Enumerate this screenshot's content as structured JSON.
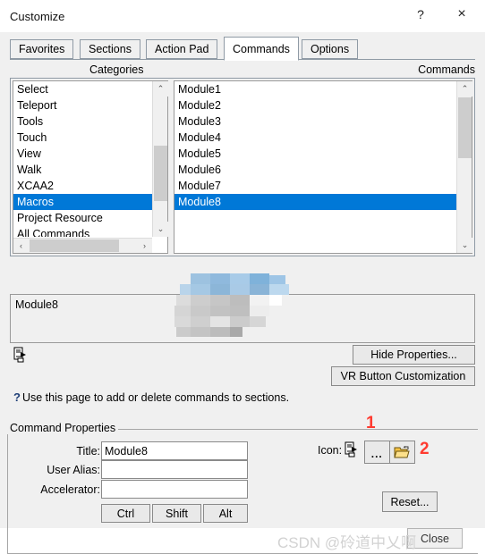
{
  "window": {
    "title": "Customize",
    "help_button": "?",
    "close_button": "×"
  },
  "tabs": [
    {
      "label": "Favorites",
      "selected": false
    },
    {
      "label": "Sections",
      "selected": false
    },
    {
      "label": "Action Pad",
      "selected": false
    },
    {
      "label": "Commands",
      "selected": true
    },
    {
      "label": "Options",
      "selected": false
    }
  ],
  "columns": {
    "categories_header": "Categories",
    "commands_header": "Commands"
  },
  "categories": {
    "items": [
      "Select",
      "Teleport",
      "Tools",
      "Touch",
      "View",
      "Walk",
      "XCAA2",
      "Macros",
      "Project Resource",
      "All Commands"
    ],
    "selected_index": 7,
    "scrollbar": {
      "up_arrow": "⌃",
      "down_arrow": "⌄",
      "left_arrow": "‹",
      "right_arrow": "›"
    }
  },
  "commands": {
    "items": [
      "Module1",
      "Module2",
      "Module3",
      "Module4",
      "Module5",
      "Module6",
      "Module7",
      "Module8"
    ],
    "selected_index": 7,
    "scrollbar": {
      "up_arrow": "⌃",
      "down_arrow": "⌄"
    }
  },
  "description": {
    "text": "Module8"
  },
  "buttons": {
    "hide_properties": "Hide Properties...",
    "vr_button_customization": "VR Button Customization",
    "reset": "Reset...",
    "close": "Close"
  },
  "help": {
    "icon": "?",
    "text": "Use this page to add or delete commands to sections."
  },
  "command_properties": {
    "legend": "Command Properties",
    "title_label": "Title:",
    "title_value": "Module8",
    "user_alias_label": "User Alias:",
    "user_alias_value": "",
    "accelerator_label": "Accelerator:",
    "accelerator_value": "",
    "modifier_keys": [
      "Ctrl",
      "Shift",
      "Alt"
    ],
    "icon_label": "Icon:",
    "icon_dots_button": "...",
    "icon_folder_button": "open-folder"
  },
  "annotations": [
    {
      "label": "1"
    },
    {
      "label": "2"
    }
  ],
  "watermark": {
    "text": "CSDN @砱道中乂啊"
  },
  "colors": {
    "selection_blue": "#0078d7",
    "annotation_red": "#ff3b30",
    "dialog_bg": "#f0f0f0",
    "folder_yellow": "#f5c242"
  }
}
